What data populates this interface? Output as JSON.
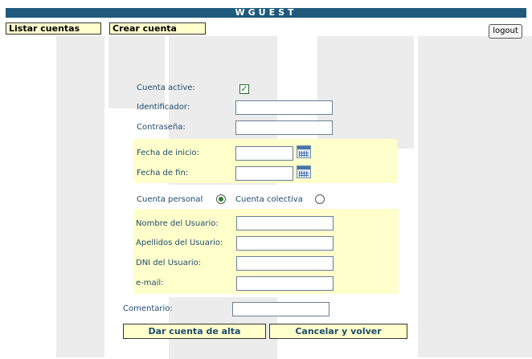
{
  "header": {
    "title": "WGUEST"
  },
  "nav": {
    "list_accounts": "Listar cuentas",
    "create_account": "Crear cuenta",
    "logout": "logout"
  },
  "form": {
    "active_label": "Cuenta active:",
    "active_checked": true,
    "identifier_label": "Identificador:",
    "password_label": "Contraseña:",
    "start_date_label": "Fecha de inicio:",
    "end_date_label": "Fecha de fin:",
    "personal_label": "Cuenta personal",
    "collective_label": "Cuenta colectiva",
    "account_type_selected": "Cuenta personal",
    "user_name_label": "Nombre del Usuario:",
    "user_surname_label": "Apellidos del Usuario:",
    "user_dni_label": "DNI del Usuario:",
    "email_label": "e-mail:",
    "comment_label": "Comentario:",
    "submit_label": "Dar cuenta de alta",
    "cancel_label": "Cancelar y volver",
    "check_glyph": "✓"
  },
  "colors": {
    "header_bg": "#1f5a7c",
    "highlight_bg": "#ffffcc",
    "label_text": "#1e4a6e"
  },
  "icons": {
    "date_picker": "calendar-icon"
  }
}
